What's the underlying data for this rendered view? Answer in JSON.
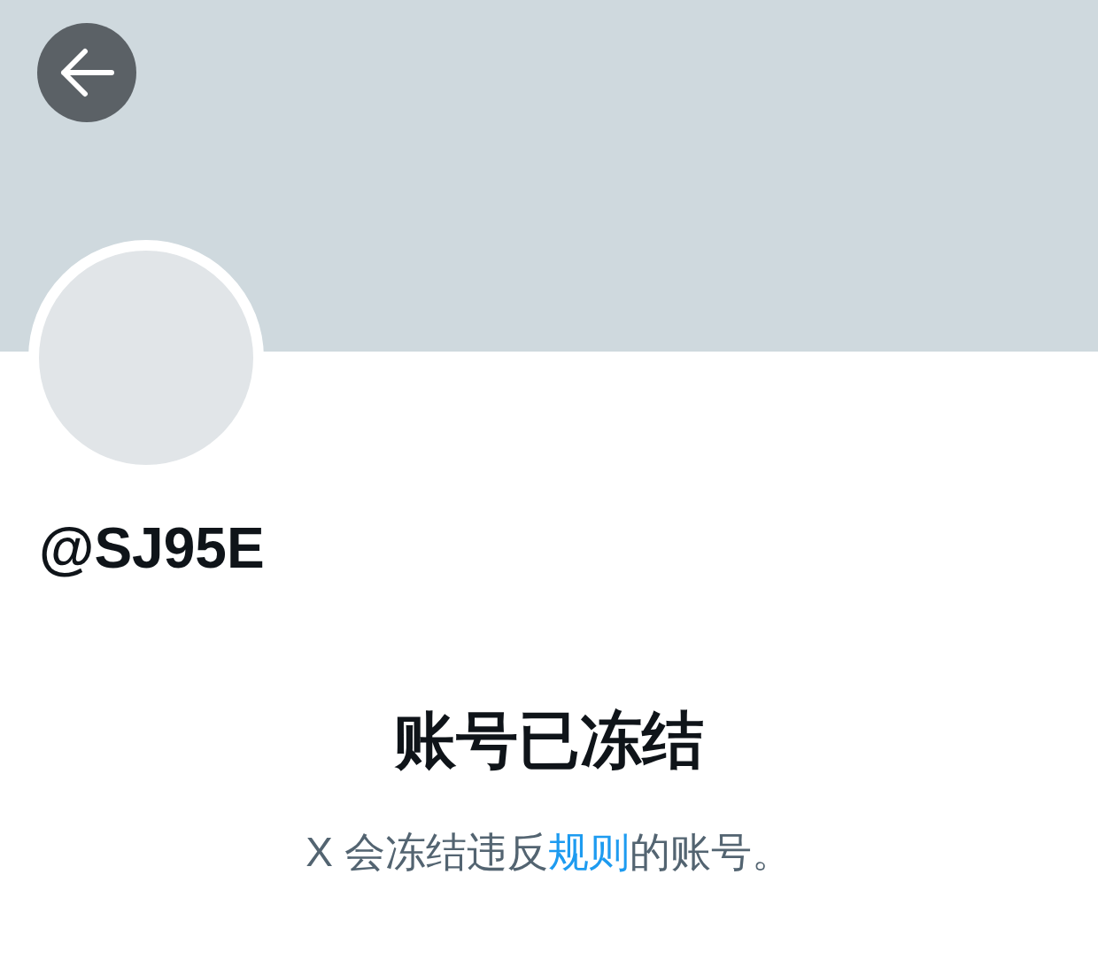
{
  "header": {
    "back_button": {
      "kind": "back"
    }
  },
  "profile": {
    "handle": "@SJ95E"
  },
  "notice": {
    "title": "账号已冻结",
    "message": {
      "before": "X 会冻结违反",
      "link": "规则",
      "after": "的账号。"
    }
  }
}
